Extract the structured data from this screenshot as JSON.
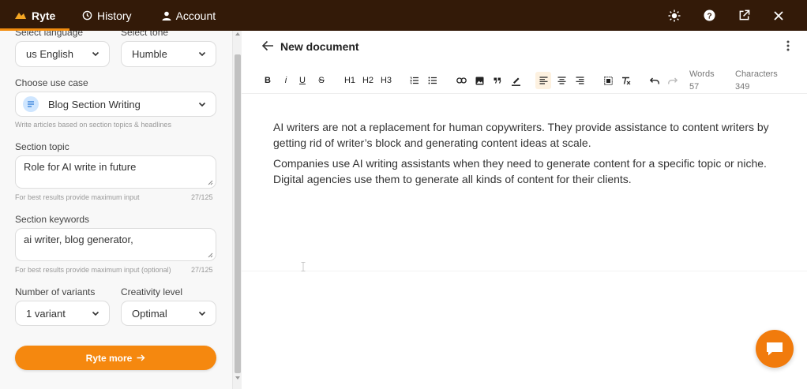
{
  "nav": {
    "brand": "Ryte",
    "history": "History",
    "account": "Account",
    "right_icons": [
      "sun-icon",
      "help-icon",
      "external-link-icon",
      "close-icon"
    ]
  },
  "sidebar": {
    "language_label": "Select language",
    "language_value": "us English",
    "tone_label": "Select tone",
    "tone_value": "Humble",
    "usecase_label": "Choose use case",
    "usecase_value": "Blog Section Writing",
    "usecase_hint": "Write articles based on section topics & headlines",
    "topic_label": "Section topic",
    "topic_value": "Role for AI write in future",
    "topic_hint": "For best results provide maximum input",
    "topic_count": "27/125",
    "keywords_label": "Section keywords",
    "keywords_value": "ai writer, blog generator,",
    "keywords_hint": "For best results provide maximum input (optional)",
    "keywords_count": "27/125",
    "variants_label": "Number of variants",
    "variants_value": "1 variant",
    "creativity_label": "Creativity level",
    "creativity_value": "Optimal",
    "submit_label": "Ryte more"
  },
  "editor": {
    "title": "New document",
    "toolbar": {
      "bold": "B",
      "italic": "i",
      "underline": "U",
      "strike": "S",
      "h1": "H1",
      "h2": "H2",
      "h3": "H3"
    },
    "words_label": "Words",
    "words_value": "57",
    "chars_label": "Characters",
    "chars_value": "349",
    "paragraphs": [
      "AI writers are not a replacement for human copywriters. They provide assistance to content writers by getting rid of writer’s block and generating content ideas at scale.",
      "Companies use AI writing assistants when they need to generate content for a specific topic or niche. Digital agencies use them to generate all kinds of content for their clients."
    ]
  },
  "colors": {
    "topbar": "#331a08",
    "accent": "#f5880f",
    "chat": "#f17b0c"
  }
}
